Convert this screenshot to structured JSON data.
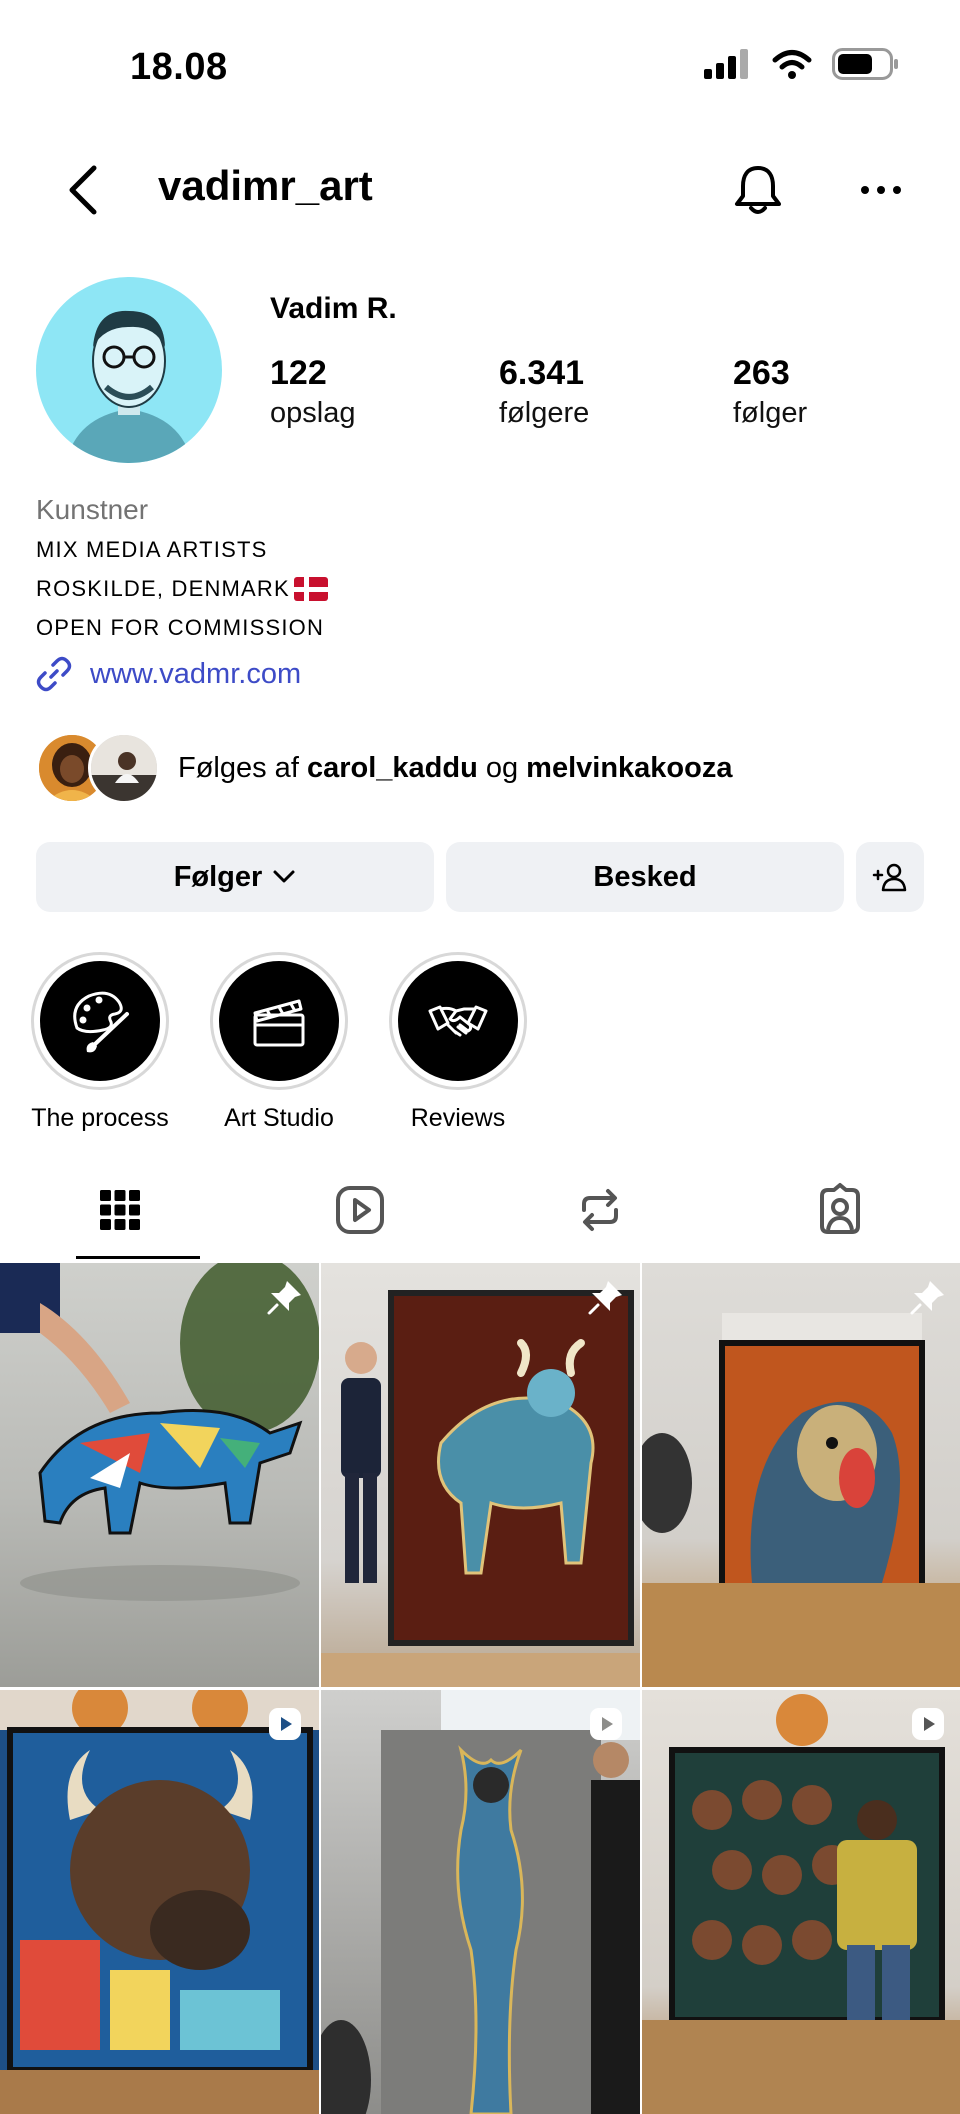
{
  "status_bar": {
    "time": "18.08"
  },
  "header": {
    "username": "vadimr_art"
  },
  "profile": {
    "display_name": "Vadim R.",
    "stats": [
      {
        "value": "122",
        "label": "opslag"
      },
      {
        "value": "6.341",
        "label": "følgere"
      },
      {
        "value": "263",
        "label": "følger"
      }
    ],
    "category": "Kunstner",
    "bio_lines": [
      "MIX MEDIA ARTISTS",
      "ROSKILDE, DENMARK",
      "OPEN FOR COMMISSION"
    ],
    "website": "www.vadmr.com"
  },
  "followed_by": {
    "prefix": "Følges af",
    "user1": "carol_kaddu",
    "conjunction": "og",
    "user2": "melvinkakooza"
  },
  "actions": {
    "follow_label": "Følger",
    "message_label": "Besked"
  },
  "highlights": [
    {
      "label": "The process",
      "icon": "palette-icon"
    },
    {
      "label": "Art Studio",
      "icon": "clapperboard-icon"
    },
    {
      "label": "Reviews",
      "icon": "handshake-icon"
    }
  ],
  "tabs": [
    {
      "icon": "grid-icon",
      "active": true
    },
    {
      "icon": "reels-icon",
      "active": false
    },
    {
      "icon": "reposts-icon",
      "active": false
    },
    {
      "icon": "tagged-icon",
      "active": false
    }
  ],
  "posts": [
    {
      "subject": "patterned bull sculpture held by hand",
      "badge": "pin-icon"
    },
    {
      "subject": "man standing beside bull painting",
      "badge": "pin-icon"
    },
    {
      "subject": "mandrill portrait painting",
      "badge": "pin-icon"
    },
    {
      "subject": "buffalo pop-art painting",
      "badge": "reel-icon"
    },
    {
      "subject": "figure painting beside man",
      "badge": "reel-icon"
    },
    {
      "subject": "group portrait painting with man",
      "badge": "reel-icon"
    }
  ],
  "colors": {
    "link": "#3d4bc7",
    "button_bg": "#eff1f4",
    "avatar_bg": "#8ee6f5",
    "muted_text": "#737373"
  }
}
